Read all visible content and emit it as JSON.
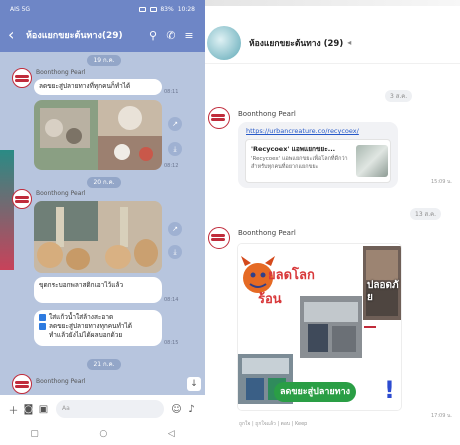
{
  "phone": {
    "status": {
      "carrier": "AIS 5G",
      "battery": "83%",
      "time": "10:28"
    },
    "header": {
      "title": "ห้องแยกขยะต้นทาง(29)",
      "back_icon": "chevron-left-icon",
      "search_icon": "search-icon",
      "phone_icon": "phone-icon",
      "menu_icon": "menu-icon"
    },
    "dates": [
      "19 ก.ค.",
      "20 ก.ค.",
      "21 ก.ค."
    ],
    "messages": [
      {
        "sender": "Boonthong Pearl",
        "text": "ลดขยะสู่ปลายทางที่ทุกคนก็ทำได้",
        "time": "08:11"
      },
      {
        "sender": "Boonthong Pearl",
        "time": "08:12"
      },
      {
        "text": "ขุดกระบอกพลาสติกเอาไว้แล้ว",
        "time": "08:14"
      },
      {
        "lines": [
          "ใส่แก้วน้ำใส่ล้างสะอาด",
          "ลดขยะสู่ปลายทางทุกคนทำได้",
          "ทำแล้วยังไม่ได้ผลบอกด้วย"
        ],
        "time": "08:15"
      },
      {
        "sender": "Boonthong Pearl"
      }
    ],
    "input_placeholder": "Aa",
    "nav": [
      "▢",
      "○",
      "◁"
    ]
  },
  "desktop": {
    "title": "ห้องแยกขยะต้นทาง (29)",
    "dates": [
      "3 ส.ค.",
      "13 ส.ค."
    ],
    "sender": "Boonthong Pearl",
    "link": "https://urbancreature.co/recycoex/",
    "card": {
      "title": "'Recycoex' แอพแยกขยะ...",
      "desc": "'Recycoex' แอพแยกขยะเพื่อโลกที่ดีกว่า สำหรับทุกคนที่อยากแยกขยะ"
    },
    "times": [
      "15:09 น.",
      "17:09 น."
    ],
    "poster": {
      "line1": "ยลดโลก",
      "line2": "ร้อน",
      "banner": "ลดขยะสู่ปลายทาง",
      "side": "ปลอดภัย",
      "exclaim": "!"
    },
    "reactions": "ถูกใจ | ถูกใจแล้ว | ตอบ | Keep"
  },
  "colors": {
    "header_blue": "#6e86c6",
    "chat_bg": "#b7c5de",
    "link": "#2659c8",
    "logo_red": "#c02b3b"
  }
}
